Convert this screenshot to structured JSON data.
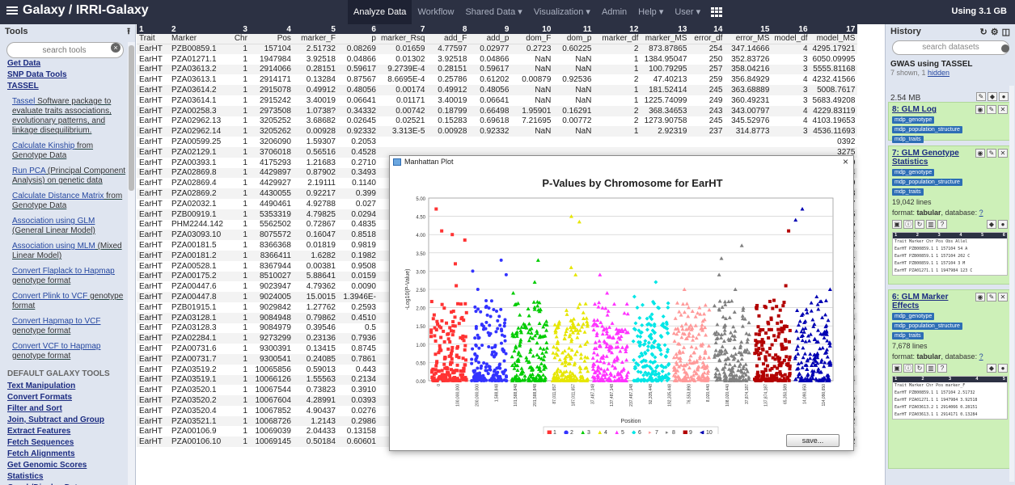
{
  "topbar": {
    "brand": "Galaxy / IRRI-Galaxy",
    "nav": [
      {
        "label": "Analyze Data",
        "active": true
      },
      {
        "label": "Workflow",
        "active": false
      },
      {
        "label": "Shared Data ▾",
        "active": false
      },
      {
        "label": "Visualization ▾",
        "active": false
      },
      {
        "label": "Admin",
        "active": false
      },
      {
        "label": "Help ▾",
        "active": false
      },
      {
        "label": "User ▾",
        "active": false
      }
    ],
    "quota": "Using 3.1 GB"
  },
  "tools": {
    "title": "Tools",
    "upload_icon": "upload-icon",
    "search_placeholder": "search tools",
    "items": [
      {
        "kind": "link",
        "label": "Get Data"
      },
      {
        "kind": "link",
        "label": "SNP Data Tools"
      },
      {
        "kind": "link",
        "label": "TASSEL"
      },
      {
        "kind": "sub",
        "link": "Tassel",
        "desc": " Software package to evaluate traits associations, evolutionary patterns, and linkage disequilibrium."
      },
      {
        "kind": "sub",
        "link": "Calculate Kinship",
        "desc": " from Genotype Data"
      },
      {
        "kind": "sub",
        "link": "Run PCA",
        "desc": " (Principal Component Analysis) on genetic data"
      },
      {
        "kind": "sub",
        "link": "Calculate Distance Matrix",
        "desc": " from Genotype Data"
      },
      {
        "kind": "sub",
        "link": "Association using GLM",
        "desc": " (General Linear Model)"
      },
      {
        "kind": "sub",
        "link": "Association using MLM",
        "desc": " (Mixed Linear Model)"
      },
      {
        "kind": "sub",
        "link": "Convert Flaplack to Hapmap",
        "desc": " genotype format"
      },
      {
        "kind": "sub",
        "link": "Convert Plink to VCF",
        "desc": " genotype format"
      },
      {
        "kind": "sub",
        "link": "Convert Hapmap to VCF",
        "desc": " genotype format"
      },
      {
        "kind": "sub",
        "link": "Convert VCF to Hapmap",
        "desc": " genotype format"
      },
      {
        "kind": "section",
        "label": "DEFAULT GALAXY TOOLS"
      },
      {
        "kind": "link",
        "label": "Text Manipulation"
      },
      {
        "kind": "link",
        "label": "Convert Formats"
      },
      {
        "kind": "link",
        "label": "Filter and Sort"
      },
      {
        "kind": "link",
        "label": "Join, Subtract and Group"
      },
      {
        "kind": "link",
        "label": "Extract Features"
      },
      {
        "kind": "link",
        "label": "Fetch Sequences"
      },
      {
        "kind": "link",
        "label": "Fetch Alignments"
      },
      {
        "kind": "link",
        "label": "Get Genomic Scores"
      },
      {
        "kind": "link",
        "label": "Statistics"
      },
      {
        "kind": "link",
        "label": "Graph/Display Data"
      },
      {
        "kind": "link",
        "label": "Phenotype Association"
      }
    ]
  },
  "table": {
    "col_numbers": [
      "1",
      "2",
      "3",
      "4",
      "5",
      "6",
      "7",
      "8",
      "9",
      "10",
      "11",
      "12",
      "13",
      "14",
      "15",
      "16",
      "17"
    ],
    "headers": [
      "Trait",
      "Marker",
      "Chr",
      "Pos",
      "marker_F",
      "p",
      "marker_Rsq",
      "add_F",
      "add_p",
      "dom_F",
      "dom_p",
      "marker_df",
      "marker_MS",
      "error_df",
      "error_MS",
      "model_df",
      "model_MS"
    ],
    "rows": [
      [
        "EarHT",
        "PZB00859.1",
        "1",
        "157104",
        "2.51732",
        "0.08269",
        "0.01659",
        "4.77597",
        "0.02977",
        "0.2723",
        "0.60225",
        "2",
        "873.87865",
        "254",
        "347.14666",
        "4",
        "4295.17921"
      ],
      [
        "EarHT",
        "PZA01271.1",
        "1",
        "1947984",
        "3.92518",
        "0.04866",
        "0.01302",
        "3.92518",
        "0.04866",
        "NaN",
        "NaN",
        "1",
        "1384.95047",
        "250",
        "352.83726",
        "3",
        "6050.09995"
      ],
      [
        "EarHT",
        "PZA03613.2",
        "1",
        "2914066",
        "0.28151",
        "0.59617",
        "9.2739E-4",
        "0.28151",
        "0.59617",
        "NaN",
        "NaN",
        "1",
        "100.79295",
        "257",
        "358.04216",
        "3",
        "5555.81168"
      ],
      [
        "EarHT",
        "PZA03613.1",
        "1",
        "2914171",
        "0.13284",
        "0.87567",
        "8.6695E-4",
        "0.25786",
        "0.61202",
        "0.00879",
        "0.92536",
        "2",
        "47.40213",
        "259",
        "356.84929",
        "4",
        "4232.41566"
      ],
      [
        "EarHT",
        "PZA03614.2",
        "1",
        "2915078",
        "0.49912",
        "0.48056",
        "0.00174",
        "0.49912",
        "0.48056",
        "NaN",
        "NaN",
        "1",
        "181.52414",
        "245",
        "363.68889",
        "3",
        "5008.7617"
      ],
      [
        "EarHT",
        "PZA03614.1",
        "1",
        "2915242",
        "3.40019",
        "0.06641",
        "0.01171",
        "3.40019",
        "0.06641",
        "NaN",
        "NaN",
        "1",
        "1225.74099",
        "249",
        "360.49231",
        "3",
        "5683.49208"
      ],
      [
        "EarHT",
        "PZA00258.3",
        "1",
        "2973508",
        "1.0738?",
        "0.34332",
        "0.00742",
        "0.18799",
        "0.66498",
        "1.95901",
        "0.16291",
        "2",
        "368.34653",
        "243",
        "343.00797",
        "4",
        "4229.83119"
      ],
      [
        "EarHT",
        "PZA02962.13",
        "1",
        "3205252",
        "3.68682",
        "0.02645",
        "0.02521",
        "0.15283",
        "0.69618",
        "7.21695",
        "0.00772",
        "2",
        "1273.90758",
        "245",
        "345.52976",
        "4",
        "4103.19653"
      ],
      [
        "EarHT",
        "PZA02962.14",
        "1",
        "3205262",
        "0.00928",
        "0.92332",
        "3.313E-5",
        "0.00928",
        "0.92332",
        "NaN",
        "NaN",
        "1",
        "2.92319",
        "237",
        "314.8773",
        "3",
        "4536.11693"
      ],
      [
        "EarHT",
        "PZA00599.25",
        "1",
        "3206090",
        "1.59307",
        "0.2053",
        "",
        "",
        "",
        "",
        "",
        "",
        "",
        "",
        "",
        "",
        "0392"
      ],
      [
        "EarHT",
        "PZA02129.1",
        "1",
        "3706018",
        "0.56516",
        "0.4528",
        "",
        "",
        "",
        "",
        "",
        "",
        "",
        "",
        "",
        "",
        "3275"
      ],
      [
        "EarHT",
        "PZA00393.1",
        "1",
        "4175293",
        "1.21683",
        "0.2710",
        "",
        "",
        "",
        "",
        "",
        "",
        "",
        "",
        "",
        "",
        "9889"
      ],
      [
        "EarHT",
        "PZA02869.8",
        "1",
        "4429897",
        "0.87902",
        "0.3493",
        "",
        "",
        "",
        "",
        "",
        "",
        "",
        "",
        "",
        "",
        "9684"
      ],
      [
        "EarHT",
        "PZA02869.4",
        "1",
        "4429927",
        "2.19111",
        "0.1140",
        "",
        "",
        "",
        "",
        "",
        "",
        "",
        "",
        "",
        "",
        "3519"
      ],
      [
        "EarHT",
        "PZA02869.2",
        "1",
        "4430055",
        "0.92217",
        "0.399",
        "",
        "",
        "",
        "",
        "",
        "",
        "",
        "",
        "",
        "",
        "8503"
      ],
      [
        "EarHT",
        "PZA02032.1",
        "1",
        "4490461",
        "4.92788",
        "0.027",
        "",
        "",
        "",
        "",
        "",
        "",
        "",
        "",
        "",
        "",
        "5437"
      ],
      [
        "EarHT",
        "PZB00919.1",
        "1",
        "5353319",
        "4.79825",
        "0.0294",
        "",
        "",
        "",
        "",
        "",
        "",
        "",
        "",
        "",
        "",
        "4675"
      ],
      [
        "EarHT",
        "PHM2244.142",
        "1",
        "5562502",
        "0.72867",
        "0.4835",
        "",
        "",
        "",
        "",
        "",
        "",
        "",
        "",
        "",
        "",
        "0285"
      ],
      [
        "EarHT",
        "PZA03093.10",
        "1",
        "8075572",
        "0.16047",
        "0.8518",
        "",
        "",
        "",
        "",
        "",
        "",
        "",
        "",
        "",
        "",
        "4122"
      ],
      [
        "EarHT",
        "PZA00181.5",
        "1",
        "8366368",
        "0.01819",
        "0.9819",
        "",
        "",
        "",
        "",
        "",
        "",
        "",
        "",
        "",
        "",
        "5036"
      ],
      [
        "EarHT",
        "PZA00181.2",
        "1",
        "8366411",
        "1.6282",
        "0.1982",
        "",
        "",
        "",
        "",
        "",
        "",
        "",
        "",
        "",
        "",
        "3641"
      ],
      [
        "EarHT",
        "PZA00528.1",
        "1",
        "8367944",
        "0.00381",
        "0.9508",
        "",
        "",
        "",
        "",
        "",
        "",
        "",
        "",
        "",
        "",
        "5216"
      ],
      [
        "EarHT",
        "PZA00175.2",
        "1",
        "8510027",
        "5.88641",
        "0.0159",
        "",
        "",
        "",
        "",
        "",
        "",
        "",
        "",
        "",
        "",
        "3492"
      ],
      [
        "EarHT",
        "PZA00447.6",
        "1",
        "9023947",
        "4.79362",
        "0.0090",
        "",
        "",
        "",
        "",
        "",
        "",
        "",
        "",
        "",
        "",
        "7013"
      ],
      [
        "EarHT",
        "PZA00447.8",
        "1",
        "9024005",
        "15.0015",
        "1.3946E-",
        "",
        "",
        "",
        "",
        "",
        "",
        "",
        "",
        "",
        "",
        "8075"
      ],
      [
        "EarHT",
        "PZB01915.1",
        "1",
        "9029842",
        "1.27762",
        "0.2593",
        "",
        "",
        "",
        "",
        "",
        "",
        "",
        "",
        "",
        "",
        "7804"
      ],
      [
        "EarHT",
        "PZA03128.1",
        "1",
        "9084948",
        "0.79862",
        "0.4510",
        "",
        "",
        "",
        "",
        "",
        "",
        "",
        "",
        "",
        "",
        "3704"
      ],
      [
        "EarHT",
        "PZA03128.3",
        "1",
        "9084979",
        "0.39546",
        "0.5",
        "",
        "",
        "",
        "",
        "",
        "",
        "",
        "",
        "",
        "",
        "5944"
      ],
      [
        "EarHT",
        "PZA02284.1",
        "1",
        "9273299",
        "0.23136",
        "0.7936",
        "",
        "",
        "",
        "",
        "",
        "",
        "",
        "",
        "",
        "",
        "3259"
      ],
      [
        "EarHT",
        "PZA00731.6",
        "1",
        "9300391",
        "0.13415",
        "0.8745",
        "",
        "",
        "",
        "",
        "",
        "",
        "",
        "",
        "",
        "",
        "3843"
      ],
      [
        "EarHT",
        "PZA00731.7",
        "1",
        "9300541",
        "0.24085",
        "0.7861",
        "",
        "",
        "",
        "",
        "",
        "",
        "",
        "",
        "",
        "",
        "5286"
      ],
      [
        "EarHT",
        "PZA03519.2",
        "1",
        "10065856",
        "0.59013",
        "0.443",
        "",
        "",
        "",
        "",
        "",
        "",
        "",
        "",
        "",
        "",
        "2757"
      ],
      [
        "EarHT",
        "PZA03519.1",
        "1",
        "10066126",
        "1.55563",
        "0.2134",
        "",
        "",
        "",
        "",
        "",
        "",
        "",
        "",
        "",
        "",
        "5594"
      ],
      [
        "EarHT",
        "PZA03520.1",
        "1",
        "10067544",
        "0.73823",
        "0.3910",
        "",
        "",
        "",
        "",
        "",
        "",
        "",
        "",
        "",
        "",
        "0031"
      ],
      [
        "EarHT",
        "PZA03520.2",
        "1",
        "10067604",
        "4.28991",
        "0.0393",
        "",
        "",
        "",
        "",
        "",
        "",
        "",
        "",
        "",
        "",
        "1952"
      ],
      [
        "EarHT",
        "PZA03520.4",
        "1",
        "10067852",
        "4.90437",
        "0.0276",
        "",
        "",
        "",
        "",
        "",
        "",
        "",
        "",
        "",
        "",
        "5748"
      ],
      [
        "EarHT",
        "PZA03521.1",
        "1",
        "10068726",
        "1.2143",
        "0.2986",
        "0.00786",
        "2.39097",
        "0.12325",
        "0.04639",
        "0.82964",
        "2",
        "429.25166",
        "259",
        "353.49812",
        "4",
        "4403.40452"
      ],
      [
        "EarHT",
        "PZA00106.9",
        "1",
        "10069039",
        "2.04433",
        "0.13158",
        "0.01342",
        "3.66395",
        "0.05672",
        "0.43283",
        "0.5112",
        "2",
        "714.61026",
        "255",
        "349.55716",
        "4",
        "4332.60974"
      ],
      [
        "EarHT",
        "PZA00106.10",
        "1",
        "10069145",
        "0.50184",
        "0.60601",
        "0.0033",
        "0.94297",
        "0.33243",
        "0.06416",
        "0.80024",
        "2",
        "177.64654",
        "255",
        "353.99111",
        "4",
        "4388.9292"
      ]
    ]
  },
  "plot_window": {
    "window_title": "Manhattan Plot",
    "close_label": "×",
    "save_label": "save...",
    "colors": [
      "#ff3333",
      "#3333ff",
      "#00cc00",
      "#e6e600",
      "#ff33ff",
      "#00e6e6",
      "#ff9999",
      "#808080",
      "#b30000",
      "#0000b3"
    ],
    "legend_markers": [
      "■",
      "●",
      "▲",
      "▲",
      "▲",
      "◆",
      "▸",
      "▸",
      "■",
      "◀"
    ]
  },
  "chart_data": {
    "type": "scatter",
    "title": "P-Values by Chromosome for EarHT",
    "xlabel": "Position",
    "ylabel": "-Log10(P-Value)",
    "ylim": [
      0,
      5.0
    ],
    "yticks": [
      "0.00",
      "0.50",
      "1.00",
      "1.50",
      "2.00",
      "2.50",
      "3.00",
      "3.50",
      "4.00",
      "4.50",
      "5.00"
    ],
    "grid": true,
    "legend_placement": "bottom",
    "x_tick_labels": [
      "0",
      "100,000,000",
      "200,000,000",
      "1,588,848",
      "101,588,848",
      "201,588,848",
      "87,011,657",
      "187,011,657",
      "37,487,148",
      "137,487,148",
      "237,487,148",
      "92,335,448",
      "192,335,448",
      "76,553,890",
      "8,020,440",
      "108,020,440",
      "37,874,187",
      "137,874,187",
      "65,350,589",
      "14,090,650",
      "114,090,650"
    ],
    "series": [
      {
        "name": "1",
        "max": 4.7,
        "top_values": [
          4.1,
          3.85,
          4.0,
          4.7,
          3.2,
          2.6
        ]
      },
      {
        "name": "2",
        "max": 3.3,
        "top_values": [
          3.0,
          3.3,
          2.9,
          2.5,
          1.9
        ]
      },
      {
        "name": "3",
        "max": 3.3,
        "top_values": [
          3.3,
          2.4,
          2.7,
          2.1,
          1.8
        ]
      },
      {
        "name": "4",
        "max": 4.5,
        "top_values": [
          4.5,
          4.35,
          2.9,
          3.1,
          2.1
        ]
      },
      {
        "name": "5",
        "max": 2.9,
        "top_values": [
          2.9,
          2.4,
          2.1,
          1.8
        ]
      },
      {
        "name": "6",
        "max": 2.7,
        "top_values": [
          2.7,
          2.3,
          2.0
        ]
      },
      {
        "name": "7",
        "max": 2.5,
        "top_values": [
          2.5,
          2.0,
          1.8
        ]
      },
      {
        "name": "8",
        "max": 3.7,
        "top_values": [
          3.7,
          3.35,
          2.9,
          2.5
        ]
      },
      {
        "name": "9",
        "max": 4.1,
        "top_values": [
          4.1,
          2.6,
          2.2
        ]
      },
      {
        "name": "10",
        "max": 4.7,
        "top_values": [
          4.7,
          4.4,
          2.5,
          2.3
        ]
      }
    ]
  },
  "history": {
    "title": "History",
    "icons": [
      "refresh-icon",
      "gear-icon",
      "columns-icon"
    ],
    "search_placeholder": "search datasets",
    "name": "GWAS using TASSEL",
    "shown": "7 shown, 1 ",
    "hidden_link": "hidden",
    "size": "2.54 MB",
    "datasets": [
      {
        "title": "8: GLM Log",
        "tags": [
          "mdp_genotype",
          "mdp_population_structure",
          "mdp_traits"
        ],
        "collapsed": true
      },
      {
        "title": "7: GLM Genotype Statistics",
        "tags": [
          "mdp_genotype",
          "mdp_population_structure",
          "mdp_traits"
        ],
        "lines": "19,042 lines",
        "format_label": "format: ",
        "format": "tabular",
        "db_label": ", database: ",
        "db": "?",
        "peek_header": [
          "1",
          "2",
          "3",
          "4",
          "5",
          "6"
        ],
        "peek_rows": [
          "Trait Marker    Chr Pos     Obs Allel",
          "EarHT PZB00859.1 1  157104  54  A",
          "EarHT PZB00859.1 1  157104  202 C",
          "EarHT PZB00859.1 1  157104  3   M",
          "EarHT PZA01271.1 1  1947984 123 C"
        ]
      },
      {
        "title": "6: GLM Marker Effects",
        "tags": [
          "mdp_genotype",
          "mdp_population_structure",
          "mdp_traits"
        ],
        "lines": "7,678 lines",
        "format_label": "format: ",
        "format": "tabular",
        "db_label": ", database: ",
        "db": "?",
        "peek_header": [
          "1",
          "2",
          "3",
          "4",
          "5"
        ],
        "peek_rows": [
          "Trait Marker     Chr Pos     marker_F",
          "EarHT PZB00859.1 1  157104  2.51732",
          "EarHT PZA01271.1 1  1947984 3.92518",
          "EarHT PZA03613.2 1  2914066 0.28151",
          "EarHT PZA03613.1 1  2914171 0.13284"
        ]
      }
    ]
  }
}
